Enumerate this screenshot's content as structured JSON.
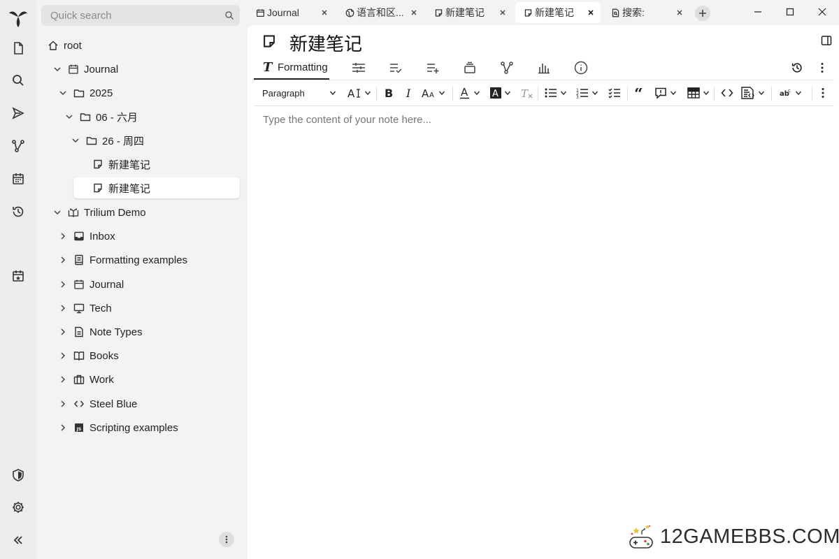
{
  "search": {
    "placeholder": "Quick search"
  },
  "tree": {
    "items": [
      {
        "label": "root",
        "icon": "home-icon"
      },
      {
        "label": "Journal",
        "icon": "calendar-icon"
      },
      {
        "label": "2025",
        "icon": "folder-icon"
      },
      {
        "label": "06 - 六月",
        "icon": "folder-icon"
      },
      {
        "label": "26 - 周四",
        "icon": "folder-icon"
      },
      {
        "label": "新建笔记",
        "icon": "note-icon"
      },
      {
        "label": "新建笔记",
        "icon": "note-icon",
        "active": true
      },
      {
        "label": "Trilium Demo",
        "icon": "book-open-icon"
      },
      {
        "label": "Inbox",
        "icon": "inbox-icon"
      },
      {
        "label": "Formatting examples",
        "icon": "book-icon"
      },
      {
        "label": "Journal",
        "icon": "calendar-icon"
      },
      {
        "label": "Tech",
        "icon": "monitor-icon"
      },
      {
        "label": "Note Types",
        "icon": "document-icon"
      },
      {
        "label": "Books",
        "icon": "book-open-icon"
      },
      {
        "label": "Work",
        "icon": "briefcase-icon"
      },
      {
        "label": "Steel Blue",
        "icon": "code-icon"
      },
      {
        "label": "Scripting examples",
        "icon": "js-file-icon"
      }
    ]
  },
  "tabs": [
    {
      "title": "Journal",
      "icon": "calendar-icon",
      "active": false
    },
    {
      "title": "语言和区...",
      "icon": "globe-icon",
      "active": false
    },
    {
      "title": "新建笔记",
      "icon": "note-icon",
      "active": false
    },
    {
      "title": "新建笔记",
      "icon": "note-icon",
      "active": true
    },
    {
      "title": "搜索:",
      "icon": "search-note-icon",
      "active": false
    }
  ],
  "note": {
    "title": "新建笔记",
    "editor_placeholder": "Type the content of your note here..."
  },
  "ribbon": {
    "formatting_label": "Formatting"
  },
  "toolbar": {
    "paragraph_label": "Paragraph"
  },
  "watermark": {
    "text": "12GAMEBBS.COM"
  },
  "colors": {
    "accent": "#222222",
    "active_bg": "#ffffff",
    "pane_bg": "#f3f3f3"
  }
}
